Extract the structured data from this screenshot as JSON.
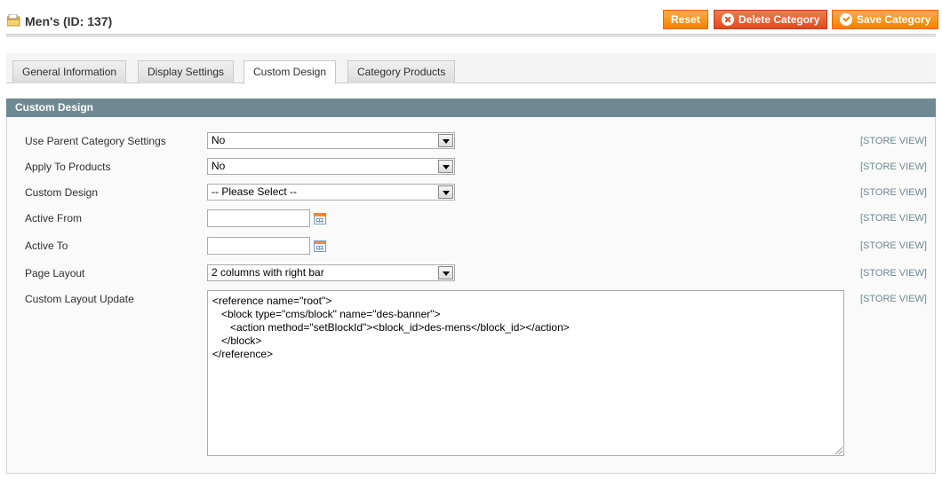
{
  "header": {
    "title": "Men's (ID: 137)",
    "reset_label": "Reset",
    "delete_label": "Delete Category",
    "save_label": "Save Category"
  },
  "tabs": [
    {
      "label": "General Information",
      "active": false
    },
    {
      "label": "Display Settings",
      "active": false
    },
    {
      "label": "Custom Design",
      "active": true
    },
    {
      "label": "Category Products",
      "active": false
    }
  ],
  "section": {
    "title": "Custom Design"
  },
  "fields": {
    "use_parent": {
      "label": "Use Parent Category Settings",
      "value": "No",
      "scope": "[STORE VIEW]"
    },
    "apply_products": {
      "label": "Apply To Products",
      "value": "No",
      "scope": "[STORE VIEW]"
    },
    "custom_design": {
      "label": "Custom Design",
      "value": "-- Please Select --",
      "scope": "[STORE VIEW]"
    },
    "active_from": {
      "label": "Active From",
      "value": "",
      "scope": "[STORE VIEW]"
    },
    "active_to": {
      "label": "Active To",
      "value": "",
      "scope": "[STORE VIEW]"
    },
    "page_layout": {
      "label": "Page Layout",
      "value": "2 columns with right bar",
      "scope": "[STORE VIEW]"
    },
    "layout_update": {
      "label": "Custom Layout Update",
      "value": "<reference name=\"root\">\n   <block type=\"cms/block\" name=\"des-banner\">\n      <action method=\"setBlockId\"><block_id>des-mens</block_id></action>\n   </block>\n</reference>",
      "scope": "[STORE VIEW]"
    }
  },
  "colors": {
    "accent_orange": "#f18200",
    "delete_red": "#e04b1b",
    "section_header": "#6f8992"
  },
  "icons": {
    "title": "folder-category-icon",
    "delete": "delete-icon",
    "save": "check-icon",
    "calendar": "calendar-icon"
  }
}
